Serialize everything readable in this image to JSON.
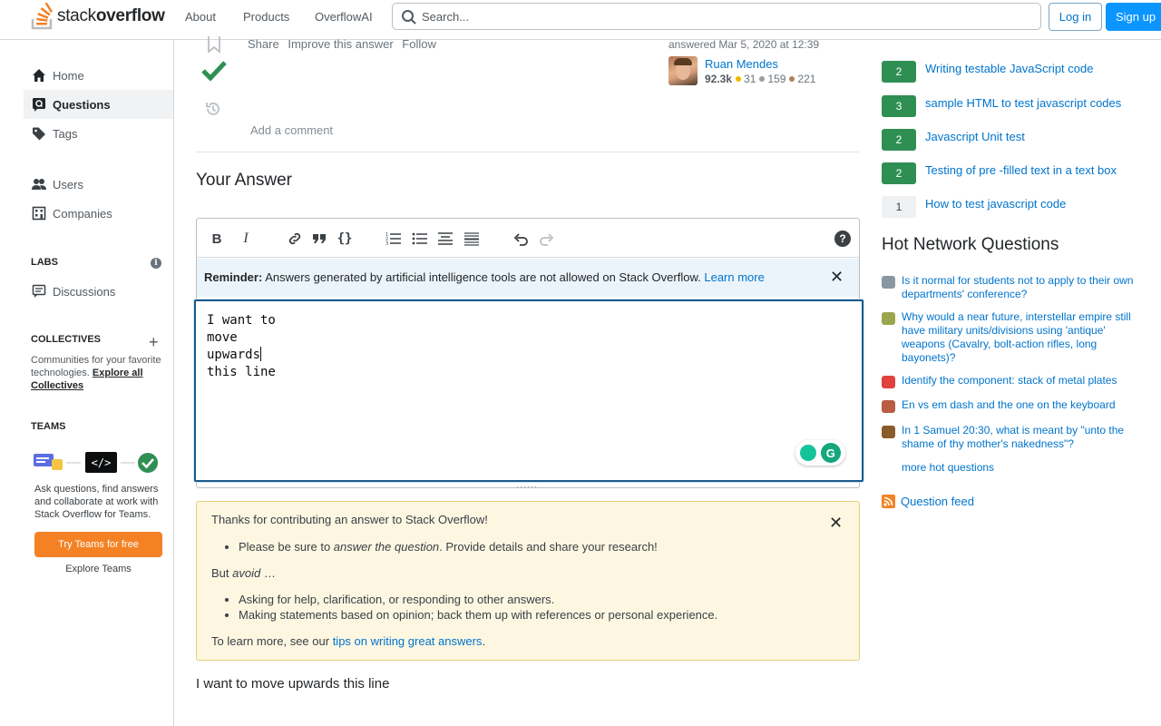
{
  "header": {
    "logo_part1": "stack",
    "logo_part2": "overflow",
    "nav": [
      "About",
      "Products",
      "OverflowAI"
    ],
    "search_placeholder": "Search...",
    "login_label": "Log in",
    "signup_label": "Sign up"
  },
  "sidebar": {
    "items": [
      {
        "label": "Home"
      },
      {
        "label": "Questions"
      },
      {
        "label": "Tags"
      },
      {
        "label": "Users"
      },
      {
        "label": "Companies"
      }
    ],
    "labs_heading": "LABS",
    "discussions_label": "Discussions",
    "collectives_heading": "COLLECTIVES",
    "collectives_text": "Communities for your favorite technologies.",
    "collectives_link": "Explore all Collectives",
    "teams_heading": "TEAMS",
    "teams_text": "Ask questions, find answers and collaborate at work with Stack Overflow for Teams.",
    "try_teams_label": "Try Teams for free",
    "explore_teams_label": "Explore Teams"
  },
  "answer": {
    "menu": [
      "Share",
      "Improve this answer",
      "Follow"
    ],
    "answered_text": "answered Mar 5, 2020 at 12:39",
    "user_name": "Ruan Mendes",
    "rep": "92.3k",
    "gold": "31",
    "silver": "159",
    "bronze": "221",
    "add_comment": "Add a comment"
  },
  "your_answer": {
    "heading": "Your Answer",
    "reminder_bold": "Reminder:",
    "reminder_text": "Answers generated by artificial intelligence tools are not allowed on Stack Overflow.",
    "reminder_link": "Learn more",
    "editor_lines": [
      "I want to",
      "move",
      "upwards",
      "this line"
    ],
    "preview": "I want to move upwards this line"
  },
  "notice": {
    "intro": "Thanks for contributing an answer to Stack Overflow!",
    "item1_pre": "Please be sure to ",
    "item1_em": "answer the question",
    "item1_post": ". Provide details and share your research!",
    "but_avoid_pre": "But ",
    "but_avoid_em": "avoid",
    "but_avoid_post": " …",
    "avoid_items": [
      "Asking for help, clarification, or responding to other answers.",
      "Making statements based on opinion; back them up with references or personal experience."
    ],
    "learn_more_pre": "To learn more, see our ",
    "learn_more_link": "tips on writing great answers",
    "learn_more_post": "."
  },
  "related": [
    {
      "score": "2",
      "title": "Writing testable JavaScript code"
    },
    {
      "score": "3",
      "title": "sample HTML to test javascript codes"
    },
    {
      "score": "2",
      "title": "Javascript Unit test"
    },
    {
      "score": "2",
      "title": "Testing of pre -filled text in a text box"
    },
    {
      "score": "1",
      "title": "How to test javascript code"
    }
  ],
  "related_partial_score": "2",
  "hot_network": {
    "title": "Hot Network Questions",
    "items": [
      {
        "text": "Is it normal for students not to apply to their own departments' conference?",
        "color": "#8a97a3"
      },
      {
        "text": "Why would a near future, interstellar empire still have military units/divisions using 'antique' weapons (Cavalry, bolt-action rifles, long bayonets)?",
        "color": "#9aa64e"
      },
      {
        "text": "Identify the component: stack of metal plates",
        "color": "#e0433f"
      },
      {
        "text": "En vs em dash and the one on the keyboard",
        "color": "#b85c43"
      },
      {
        "text": "In 1 Samuel 20:30, what is meant by \"unto the shame of thy mother's nakedness\"?",
        "color": "#8b5a2b"
      }
    ],
    "more": "more hot questions"
  },
  "feed_label": "Question feed"
}
